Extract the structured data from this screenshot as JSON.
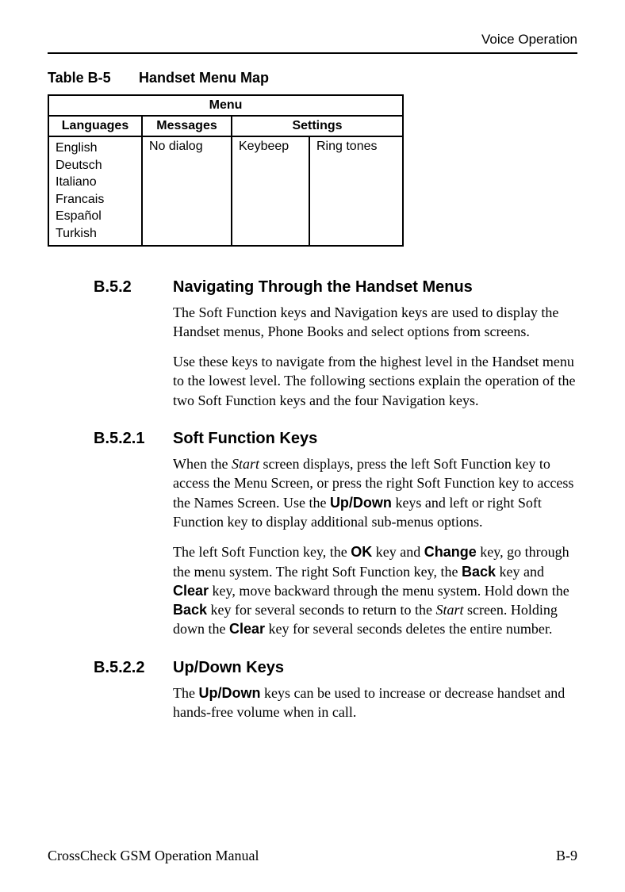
{
  "header": {
    "section": "Voice Operation"
  },
  "table": {
    "caption_number": "Table B-5",
    "caption_title": "Handset Menu Map",
    "menu_header": "Menu",
    "columns": {
      "languages": "Languages",
      "messages": "Messages",
      "settings": "Settings"
    },
    "languages_list": [
      "English",
      "Deutsch",
      "Italiano",
      "Francais",
      "Español",
      "Turkish"
    ],
    "messages_cell": "No dialog",
    "settings_cells": [
      "Keybeep",
      "Ring tones"
    ]
  },
  "sections": {
    "b52": {
      "number": "B.5.2",
      "title": "Navigating Through the Handset Menus",
      "para1": "The Soft Function keys and Navigation keys are used to display the Handset menus, Phone Books and select options from screens.",
      "para2": "Use these keys to navigate from the highest level in the Handset menu to the lowest level. The following sections explain the operation of the two Soft Function keys and the four Navigation keys."
    },
    "b521": {
      "number": "B.5.2.1",
      "title": "Soft Function Keys",
      "para1_pre": "When the ",
      "para1_i1": "Start",
      "para1_mid1": " screen displays, press the left Soft Function key to access the Menu Screen, or press the right Soft Function key to access the Names Screen. Use the ",
      "para1_b1": "Up/Down",
      "para1_mid2": " keys and left or right Soft Function key to display additional sub-menus options.",
      "para2_pre": "The left Soft Function key, the ",
      "para2_b1": "OK",
      "para2_mid1": " key and ",
      "para2_b2": "Change",
      "para2_mid2": " key, go through the menu system. The right Soft Function key, the ",
      "para2_b3": "Back",
      "para2_mid3": " key and ",
      "para2_b4": "Clear",
      "para2_mid4": " key, move backward through the menu system. Hold down the ",
      "para2_b5": "Back",
      "para2_mid5": " key for several seconds to return to the ",
      "para2_i1": "Start",
      "para2_mid6": " screen. Holding down the ",
      "para2_b6": "Clear",
      "para2_mid7": " key for several seconds deletes the entire number."
    },
    "b522": {
      "number": "B.5.2.2",
      "title": "Up/Down Keys",
      "para1_pre": "The ",
      "para1_b1": "Up/Down",
      "para1_post": " keys can be used to increase or decrease handset and hands-free volume when in call."
    }
  },
  "footer": {
    "left": "CrossCheck GSM Operation Manual",
    "right": "B-9"
  }
}
